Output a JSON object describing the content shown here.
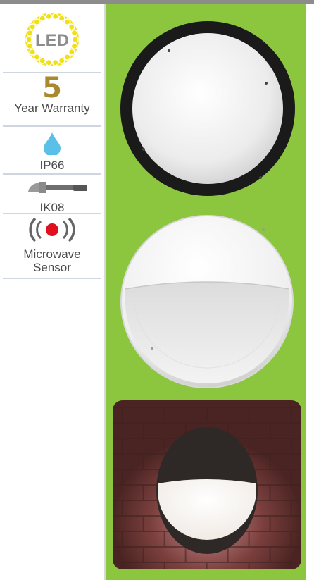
{
  "features": {
    "led": {
      "label": "LED",
      "icon": "led-bulb-ring-icon"
    },
    "warranty": {
      "number": "5",
      "label": "Year Warranty"
    },
    "ip": {
      "label": "IP66",
      "icon": "water-drop-icon"
    },
    "ik": {
      "label": "IK08",
      "icon": "hammer-icon"
    },
    "sensor": {
      "label_line1": "Microwave",
      "label_line2": "Sensor",
      "icon": "microwave-sensor-icon"
    }
  },
  "colors": {
    "accent_green": "#8cc63f",
    "led_yellow": "#f2e016",
    "warranty_gold": "#a8892e",
    "drop_blue": "#5bc0e8",
    "sensor_red": "#e0101e"
  },
  "products": [
    {
      "name": "black-trim-bulkhead-image"
    },
    {
      "name": "white-eyelid-bulkhead-image"
    },
    {
      "name": "installed-wall-light-photo"
    }
  ]
}
